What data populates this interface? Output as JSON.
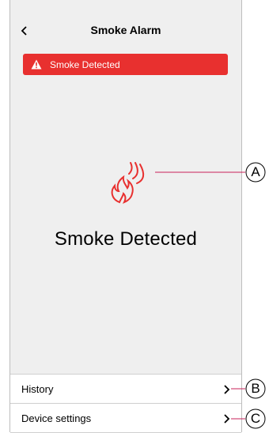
{
  "header": {
    "title": "Smoke Alarm",
    "back_icon": "chevron-left-icon"
  },
  "banner": {
    "text": "Smoke Detected",
    "icon": "warning-icon",
    "color": "#e8302f"
  },
  "status": {
    "text": "Smoke Detected",
    "icon": "smoke-alarm-icon"
  },
  "list": [
    {
      "label": "History",
      "icon": "chevron-right-icon"
    },
    {
      "label": "Device settings",
      "icon": "chevron-right-icon"
    }
  ],
  "callouts": [
    "A",
    "B",
    "C"
  ]
}
